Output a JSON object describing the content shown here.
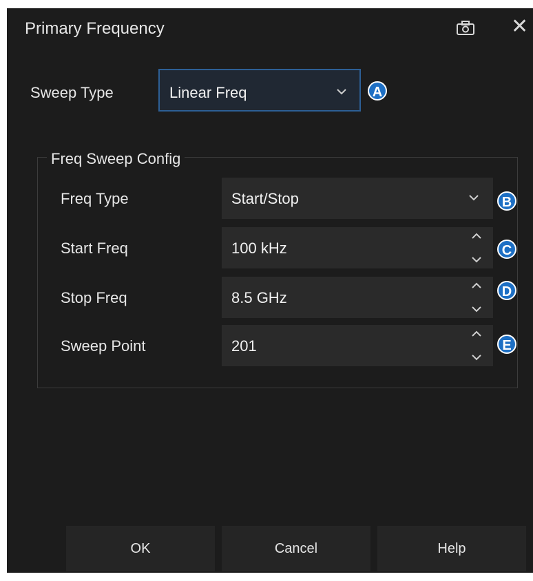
{
  "dialog": {
    "title": "Primary Frequency"
  },
  "sweep": {
    "label": "Sweep Type",
    "value": "Linear Freq",
    "badge": "A"
  },
  "config": {
    "legend": "Freq Sweep Config",
    "rows": [
      {
        "label": "Freq Type",
        "value": "Start/Stop",
        "badge": "B",
        "control": "dropdown"
      },
      {
        "label": "Start Freq",
        "value": "100 kHz",
        "badge": "C",
        "control": "spinbox"
      },
      {
        "label": "Stop Freq",
        "value": "8.5 GHz",
        "badge": "D",
        "control": "spinbox"
      },
      {
        "label": "Sweep Point",
        "value": "201",
        "badge": "E",
        "control": "spinbox"
      }
    ]
  },
  "buttons": {
    "ok": "OK",
    "cancel": "Cancel",
    "help": "Help"
  },
  "colors": {
    "dialog_bg": "#1c1c1c",
    "field_bg": "#2a2a2a",
    "selected_border": "#3b7cc9",
    "badge": "#1d6fc4"
  },
  "icons": {
    "camera": "camera-icon",
    "close": "close-icon"
  }
}
